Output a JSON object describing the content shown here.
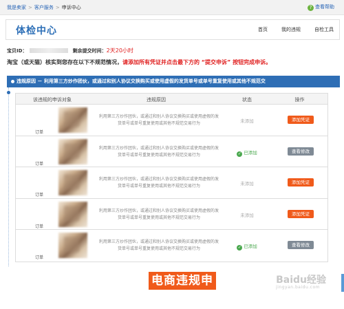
{
  "breadcrumb": [
    "我是卖家",
    "客户服务",
    "申诉中心"
  ],
  "help": "查看帮助",
  "header": {
    "title": "体检中心",
    "nav": [
      "首页",
      "我的违规",
      "自检工具"
    ]
  },
  "baby": {
    "id_label": "宝贝ID：",
    "remain_label": "剩余提交时间：",
    "remain_value": "2天20小时"
  },
  "notice": {
    "text": "淘宝（或天猫）核实到您存在以下不规范情况，",
    "red": "请添加所有凭证并点击最下方的 “提交申诉” 按钮完成申诉。"
  },
  "violation": "违规原因 － 利用第三方炒作团伙，或通过和别人协议交换购买或使用虚假的发货单号或单号重复使用或其他不规范交",
  "table": {
    "headers": [
      "该违规的申诉对象",
      "违规原因",
      "状态",
      "操作"
    ],
    "rows": [
      {
        "order": "订单",
        "reason": "利用第三方炒作团伙，或通过和别人协议交换购买或使用虚假的发货单号或单号重复使用或其他不规范交易行为",
        "status": "未添加",
        "done": false,
        "action": "添加凭证"
      },
      {
        "order": "订单",
        "reason": "利用第三方炒作团伙，或通过和别人协议交换购买或使用虚假的发货单号或单号重复使用或其他不规范交易行为",
        "status": "已添加",
        "done": true,
        "action": "查看修改"
      },
      {
        "order": "订单",
        "reason": "利用第三方炒作团伙，或通过和别人协议交换购买或使用虚假的发货单号或单号重复使用或其他不规范交易行为",
        "status": "未添加",
        "done": false,
        "action": "添加凭证"
      },
      {
        "order": "订单",
        "reason": "利用第三方炒作团伙，或通过和别人协议交换购买或使用虚假的发货单号或单号重复使用或其他不规范交易行为",
        "status": "未添加",
        "done": false,
        "action": "添加凭证"
      },
      {
        "order": "订单",
        "reason": "利用第三方炒作团伙，或通过和别人协议交换购买或使用虚假的发货单号或单号重复使用或其他不规范交易行为",
        "status": "已添加",
        "done": true,
        "action": "查看修改"
      }
    ]
  },
  "submit_button": "电商违规申",
  "watermark": "Baidu经验",
  "watermark_sub": "jingyan.baidu.com",
  "colors": {
    "accent": "#2e6eb5",
    "action": "#f05a1a",
    "success": "#4aa84e",
    "alert": "#e02020"
  }
}
